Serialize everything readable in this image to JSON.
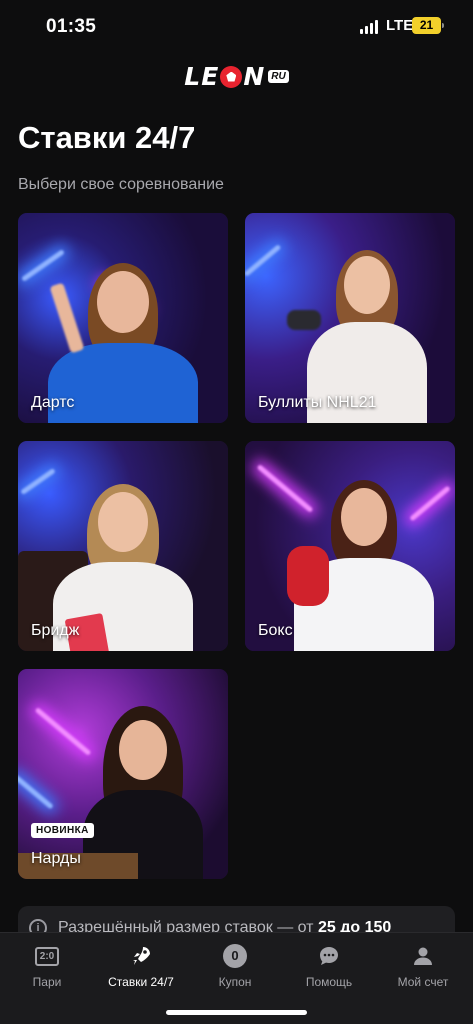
{
  "status": {
    "time": "01:35",
    "network": "LTE",
    "battery": "21"
  },
  "brand": {
    "logo_text": "LEON",
    "logo_badge": "RU"
  },
  "page": {
    "title": "Ставки 24/7",
    "subtitle": "Выбери свое соревнование"
  },
  "cards": [
    {
      "label": "Дартс",
      "badge": ""
    },
    {
      "label": "Буллиты NHL21",
      "badge": ""
    },
    {
      "label": "Бридж",
      "badge": ""
    },
    {
      "label": "Бокс",
      "badge": ""
    },
    {
      "label": "Нарды",
      "badge": "НОВИНКА"
    }
  ],
  "info": {
    "text_prefix": "Разрешённый размер ставок — от",
    "text_value": "25 до 150"
  },
  "tabs": [
    {
      "label": "Пари",
      "icon": "score-icon",
      "icon_text": "2:0"
    },
    {
      "label": "Ставки 24/7",
      "icon": "rocket-icon"
    },
    {
      "label": "Купон",
      "icon": "coupon-icon",
      "icon_text": "0"
    },
    {
      "label": "Помощь",
      "icon": "chat-icon"
    },
    {
      "label": "Мой счет",
      "icon": "user-icon"
    }
  ],
  "colors": {
    "background": "#0d0d0e",
    "tabbar": "#1b1b1d",
    "accent_red": "#e8232f",
    "neon_blue": "#3f7bff",
    "neon_pink": "#d83cff"
  }
}
